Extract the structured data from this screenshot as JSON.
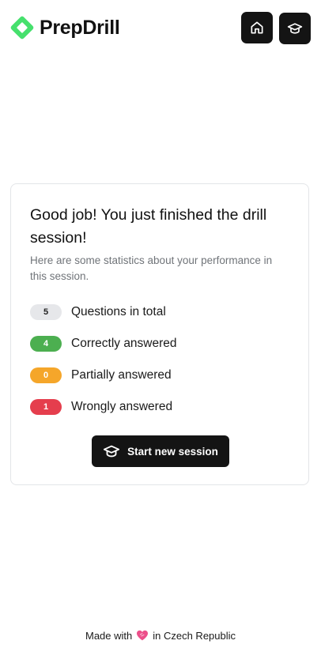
{
  "brand": {
    "name": "PrepDrill"
  },
  "header": {
    "home_icon": "home-icon",
    "cap_icon": "graduation-cap-icon"
  },
  "results": {
    "title": "Good job! You just finished the drill session!",
    "subtitle": "Here are some statistics about your performance in this session.",
    "stats": [
      {
        "value": "5",
        "label": "Questions in total",
        "color": "#e6e7ea"
      },
      {
        "value": "4",
        "label": "Correctly answered",
        "color": "#4caf50"
      },
      {
        "value": "0",
        "label": "Partially answered",
        "color": "#f5a62a"
      },
      {
        "value": "1",
        "label": "Wrongly answered",
        "color": "#e53e4d"
      }
    ],
    "start_button": "Start new session"
  },
  "footer": {
    "made_with": "Made with",
    "location": "in Czech Republic",
    "heart_icon": "heart-icon"
  },
  "colors": {
    "brand_green": "#39e06a",
    "button_dark": "#141414"
  }
}
